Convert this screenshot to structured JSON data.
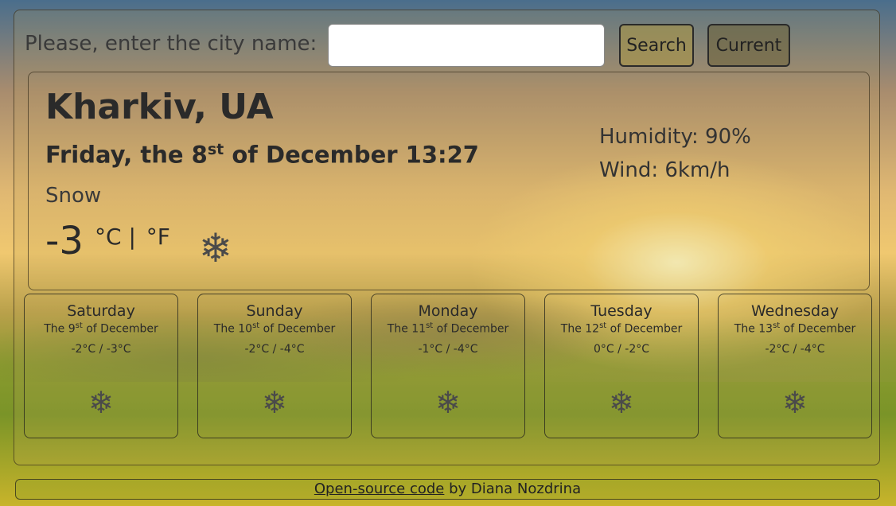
{
  "search": {
    "label": "Please, enter the city name:",
    "input_value": "",
    "search_button": "Search",
    "current_button": "Current"
  },
  "current": {
    "city": "Kharkiv, UA",
    "date_prefix": "Friday, the 8",
    "date_suffix_sup": "st",
    "date_rest": " of December 13:27",
    "description": "Snow",
    "temperature": "-3",
    "unit_c": "°C |",
    "unit_f": "°F",
    "icon": "snowflake-icon",
    "humidity": "Humidity: 90%",
    "wind": "Wind: 6km/h"
  },
  "forecast": [
    {
      "day": "Saturday",
      "date_prefix": "The 9",
      "date_sup": "st",
      "date_rest": " of December",
      "temps": "-2°C / -3°C",
      "icon": "snowflake-icon"
    },
    {
      "day": "Sunday",
      "date_prefix": "The 10",
      "date_sup": "st",
      "date_rest": " of December",
      "temps": "-2°C / -4°C",
      "icon": "snowflake-icon"
    },
    {
      "day": "Monday",
      "date_prefix": "The 11",
      "date_sup": "st",
      "date_rest": " of December",
      "temps": "-1°C / -4°C",
      "icon": "snowflake-icon"
    },
    {
      "day": "Tuesday",
      "date_prefix": "The 12",
      "date_sup": "st",
      "date_rest": " of December",
      "temps": "0°C / -2°C",
      "icon": "snowflake-icon"
    },
    {
      "day": "Wednesday",
      "date_prefix": "The 13",
      "date_sup": "st",
      "date_rest": " of December",
      "temps": "-2°C / -4°C",
      "icon": "snowflake-icon"
    }
  ],
  "footer": {
    "link_text": "Open-source code",
    "rest_text": " by Diana Nozdrina"
  }
}
